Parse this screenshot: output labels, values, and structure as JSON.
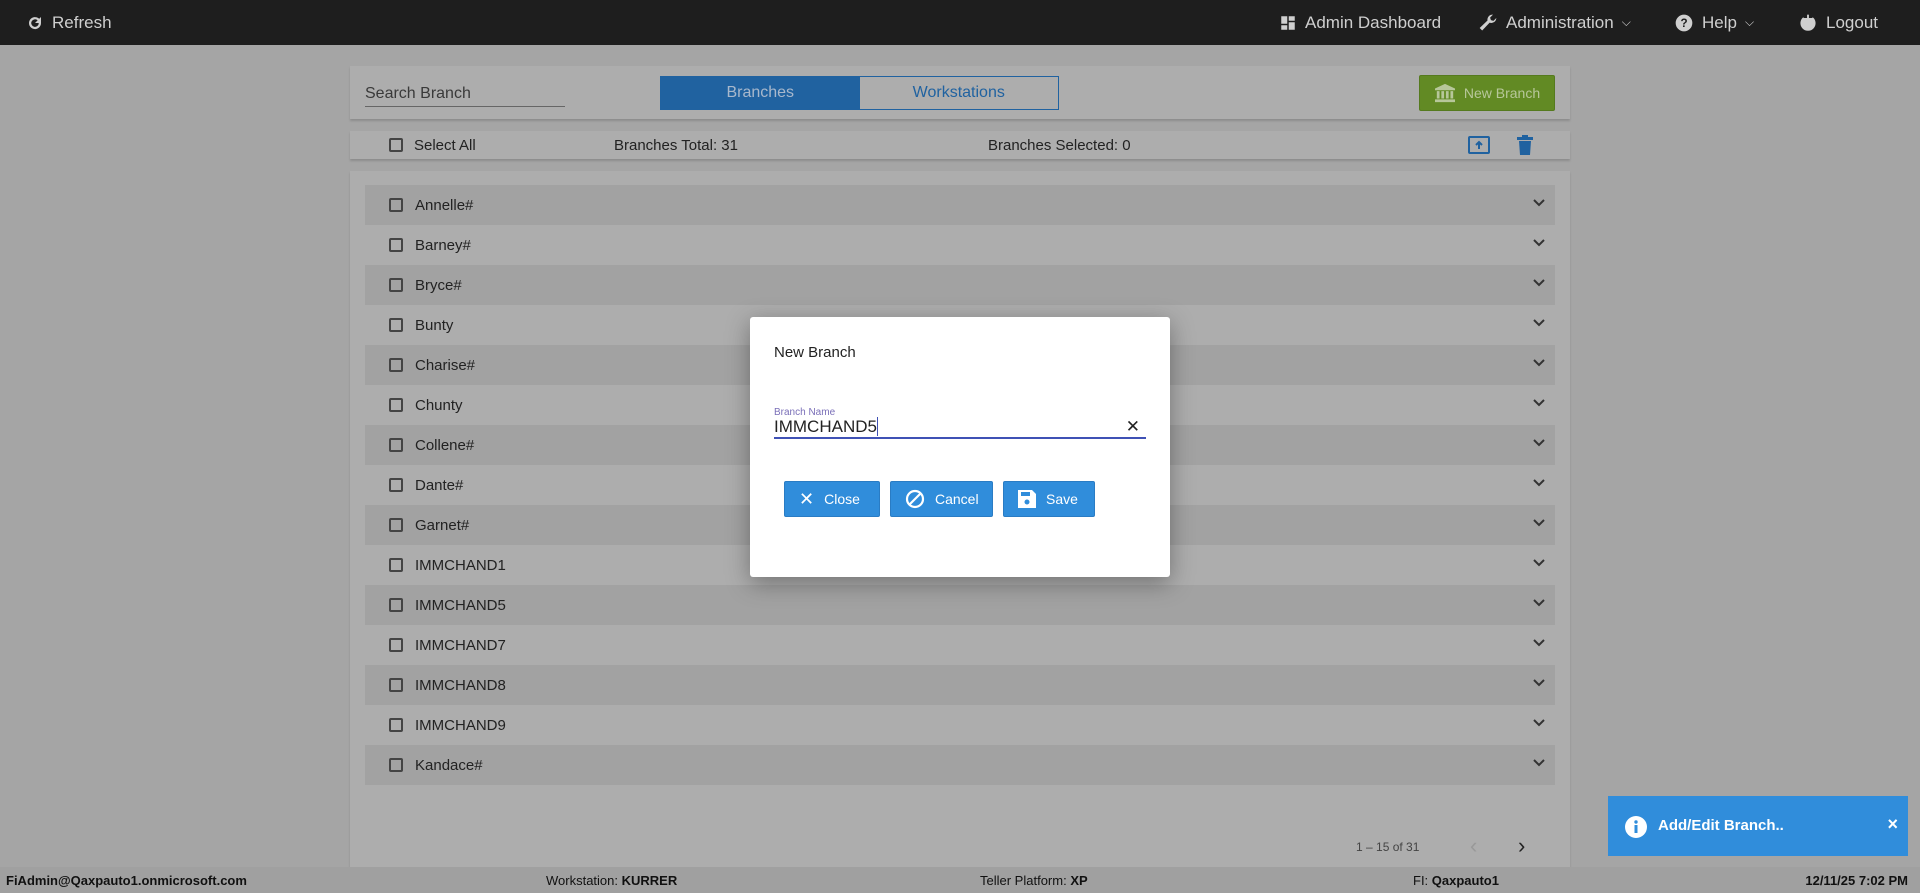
{
  "topbar": {
    "refresh": "Refresh",
    "admin_dashboard": "Admin Dashboard",
    "administration": "Administration",
    "help": "Help",
    "logout": "Logout"
  },
  "toolbar": {
    "search_placeholder": "Search Branch",
    "tabs": [
      {
        "label": "Branches",
        "active": true
      },
      {
        "label": "Workstations",
        "active": false
      }
    ],
    "new_branch": "New Branch",
    "new_branch_color": "#628a24"
  },
  "selection": {
    "select_all": "Select All",
    "total": "Branches Total: 31",
    "selected": "Branches Selected: 0"
  },
  "branches": [
    "Annelle#",
    "Barney#",
    "Bryce#",
    "Bunty",
    "Charise#",
    "Chunty",
    "Collene#",
    "Dante#",
    "Garnet#",
    "IMMCHAND1",
    "IMMCHAND5",
    "IMMCHAND7",
    "IMMCHAND8",
    "IMMCHAND9",
    "Kandace#"
  ],
  "pagination": {
    "range": "1 – 15 of 31"
  },
  "dialog": {
    "title": "New Branch",
    "field_label": "Branch Name",
    "field_value": "IMMCHAND5",
    "close": "Close",
    "cancel": "Cancel",
    "save": "Save",
    "button_color": "#308ddb"
  },
  "toast": {
    "message": "Add/Edit Branch..",
    "close": "×"
  },
  "footer": {
    "user": "FiAdmin@Qaxpauto1.onmicrosoft.com",
    "workstation_label": "Workstation: ",
    "workstation": "KURRER",
    "platform_label": "Teller Platform: ",
    "platform": "XP",
    "fi_label": "FI: ",
    "fi": "Qaxpauto1",
    "datetime": "12/11/25 7:02 PM"
  }
}
